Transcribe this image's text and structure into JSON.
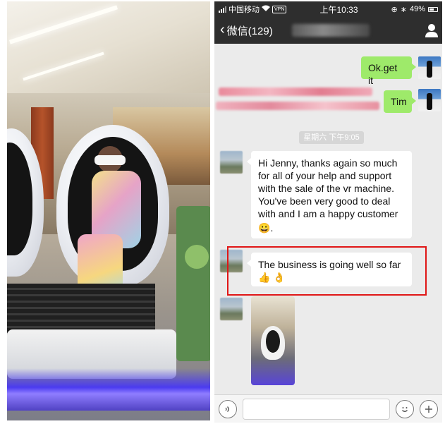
{
  "status_bar": {
    "carrier": "中国移动",
    "vpn": "VPN",
    "time": "上午10:33",
    "battery": "49%"
  },
  "nav": {
    "back_label": "微信(129)"
  },
  "messages": {
    "msg1": "Ok.get it",
    "msg2": "Tim",
    "timestamp": "星期六 下午9:05",
    "msg3": "Hi Jenny, thanks again so much for all of your help and support with the sale of the vr machine. You've been very good to deal with and I am a happy customer",
    "msg3_end": ".",
    "msg4": "The business is going well so far"
  },
  "icons": {
    "back": "chevron-left-icon",
    "contact": "person-icon",
    "voice": "voice-icon",
    "emoji": "emoji-icon",
    "more": "plus-icon"
  },
  "colors": {
    "nav_bg": "#2e2e2e",
    "chat_bg": "#ebebeb",
    "sent_bubble": "#9eea6a",
    "received_bubble": "#ffffff",
    "highlight": "#e01616"
  }
}
